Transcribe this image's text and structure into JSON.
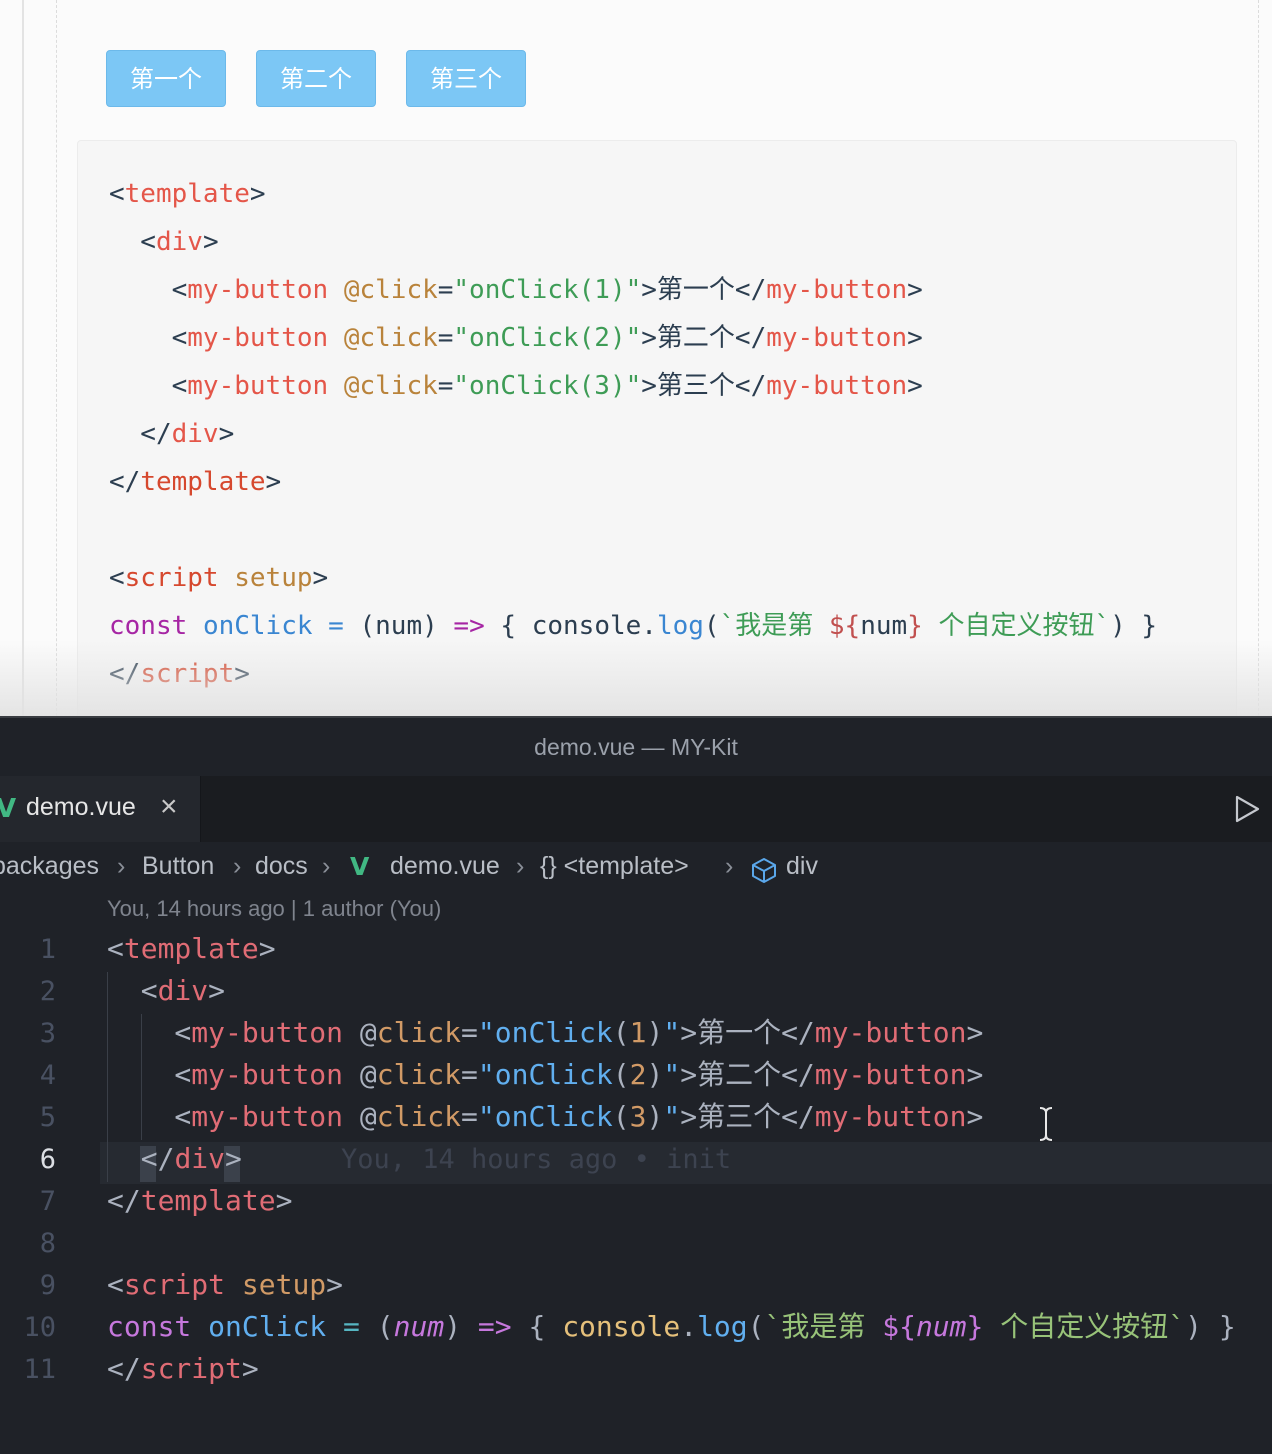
{
  "docs": {
    "buttons": [
      "第一个",
      "第二个",
      "第三个"
    ],
    "code": {
      "template_open": "template",
      "div": "div",
      "my_button": "my-button",
      "click_attr": "@click",
      "on_click_1": "\"onClick(1)\"",
      "on_click_2": "\"onClick(2)\"",
      "on_click_3": "\"onClick(3)\"",
      "label_1": "第一个",
      "label_2": "第二个",
      "label_3": "第三个",
      "script": "script",
      "setup": "setup",
      "const": "const",
      "on_click_name": "onClick",
      "params": "(num)",
      "arrow": "=>",
      "console": "console",
      "log": "log",
      "template_str_a": "`我是第 ",
      "template_interp": "${num}",
      "template_str_b": " 个自定义按钮`"
    }
  },
  "editor": {
    "window_title": "demo.vue — MY-Kit",
    "tab_label": "demo.vue",
    "tab_icon": "vue-icon",
    "run_icon": "play-icon",
    "breadcrumb": [
      "packages",
      "Button",
      "docs",
      "demo.vue",
      "{} <template>",
      "div"
    ],
    "codelens": "You, 14 hours ago | 1 author (You)",
    "blame": "You, 14 hours ago • init",
    "current_line": 6,
    "line_numbers": [
      "1",
      "2",
      "3",
      "4",
      "5",
      "6",
      "7",
      "8",
      "9",
      "10",
      "11"
    ],
    "code": {
      "template": "template",
      "div": "div",
      "my_button": "my-button",
      "at": "@",
      "click": "click",
      "on_click": "onClick",
      "n1": "1",
      "n2": "2",
      "n3": "3",
      "label_1": "第一个",
      "label_2": "第二个",
      "label_3": "第三个",
      "script": "script",
      "setup": "setup",
      "const": "const",
      "num": "num",
      "console": "console",
      "log": "log",
      "str_a": "`我是第 ",
      "str_b": " 个自定义按钮`"
    }
  },
  "colors": {
    "button_bg": "#7cc7f5",
    "editor_bg": "#1f2228",
    "vue_green": "#41b883"
  }
}
